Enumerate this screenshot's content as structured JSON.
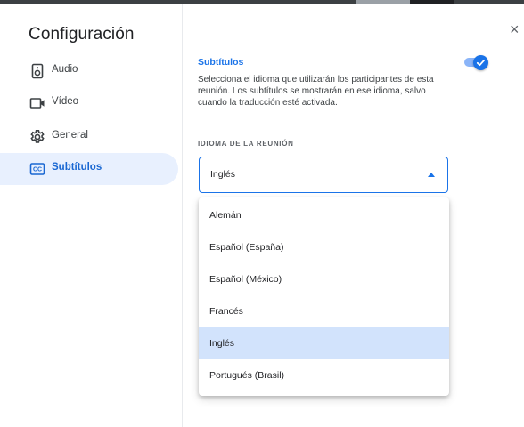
{
  "dialog": {
    "title": "Configuración",
    "close_glyph": "×"
  },
  "sidebar": {
    "items": [
      {
        "label": "Audio",
        "icon": "speaker-icon",
        "active": false
      },
      {
        "label": "Vídeo",
        "icon": "video-camera-icon",
        "active": false
      },
      {
        "label": "General",
        "icon": "gear-icon",
        "active": false
      },
      {
        "label": "Subtítulos",
        "icon": "closed-captions-icon",
        "active": true
      }
    ]
  },
  "captions": {
    "title": "Subtítulos",
    "toggle_on": true,
    "description": "Selecciona el idioma que utilizarán los participantes de esta reunión. Los subtítulos se mostrarán en ese idioma, salvo cuando la traducción esté activada.",
    "field_label": "IDIOMA DE LA REUNIÓN",
    "selected_language": "Inglés",
    "options": [
      "Alemán",
      "Español (España)",
      "Español (México)",
      "Francés",
      "Inglés",
      "Portugués (Brasil)"
    ],
    "selected_index": 4
  },
  "colors": {
    "accent": "#1a73e8",
    "active_nav_bg": "#e8f0fe",
    "selected_option_bg": "#d2e3fc"
  }
}
